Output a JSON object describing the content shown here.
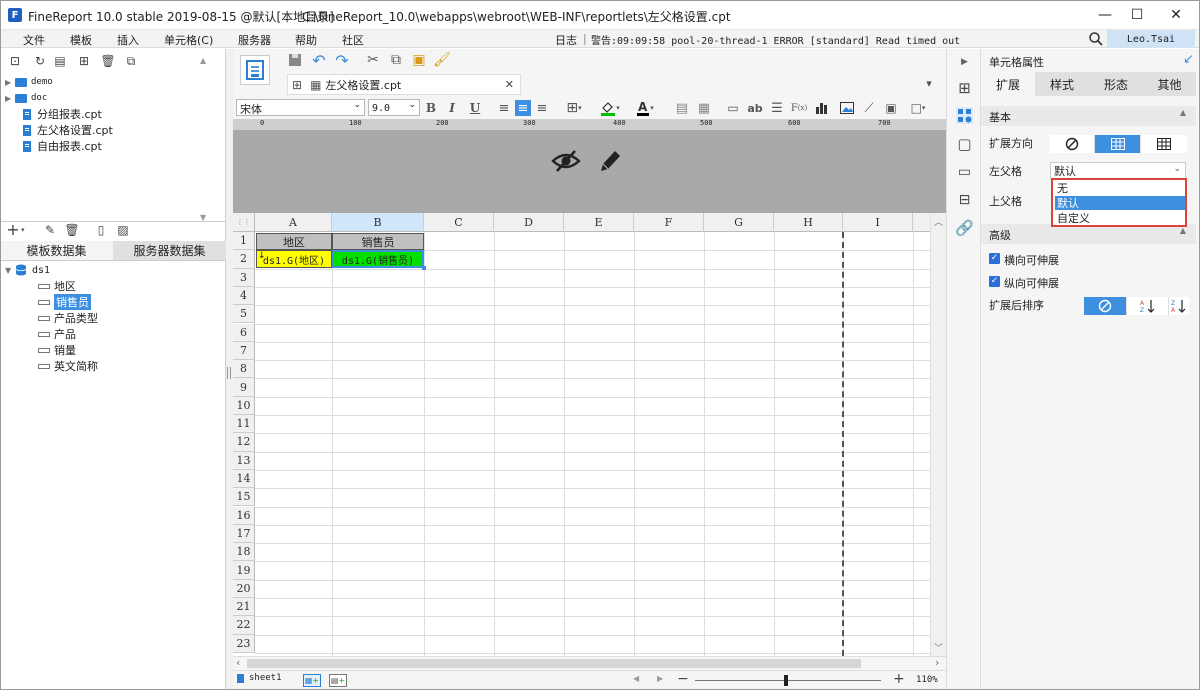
{
  "titlebar": {
    "app_title": "FineReport 10.0 stable 2019-08-15 @默认[本地目录]",
    "file_path": "C:\\FineReport_10.0\\webapps\\webroot\\WEB-INF\\reportlets\\左父格设置.cpt",
    "minimize": "—",
    "maximize": "☐",
    "close": "✕"
  },
  "menu": {
    "items": [
      "文件",
      "模板",
      "插入",
      "单元格(C)",
      "服务器",
      "帮助",
      "社区"
    ],
    "log_label": "日志",
    "warning_text": "警告:09:09:58 pool-20-thread-1 ERROR [standard] Read timed out",
    "user_name": "Leo.Tsai"
  },
  "left_panel": {
    "files": [
      {
        "name": "demo",
        "kind": "folder"
      },
      {
        "name": "doc",
        "kind": "folder"
      },
      {
        "name": "分组报表.cpt",
        "kind": "file"
      },
      {
        "name": "左父格设置.cpt",
        "kind": "file"
      },
      {
        "name": "自由报表.cpt",
        "kind": "file"
      }
    ],
    "dataset_tabs": [
      "模板数据集",
      "服务器数据集"
    ],
    "dataset": {
      "name": "ds1",
      "fields": [
        "地区",
        "销售员",
        "产品类型",
        "产品",
        "销量",
        "英文简称"
      ],
      "selected_field": "销售员"
    }
  },
  "editor": {
    "tab_label": "左父格设置.cpt",
    "font_name": "宋体",
    "font_size": "9.0",
    "bold": "B",
    "italic": "I",
    "underline": "U",
    "ruler_labels": [
      "0",
      "100",
      "200",
      "300",
      "400",
      "500",
      "600",
      "700"
    ],
    "columns": [
      "A",
      "B",
      "C",
      "D",
      "E",
      "F",
      "G",
      "H",
      "I"
    ],
    "rows": [
      "1",
      "2",
      "3",
      "4",
      "5",
      "6",
      "7",
      "8",
      "9",
      "10",
      "11",
      "12",
      "13",
      "14",
      "15",
      "16",
      "17",
      "18",
      "19",
      "20",
      "21",
      "22",
      "23"
    ],
    "cells": {
      "A1": "地区",
      "B1": "销售员",
      "A2": "ds1.G(地区)",
      "B2": "ds1.G(销售员)"
    },
    "sheet_name": "sheet1",
    "zoom": "110%",
    "colors": {
      "a2_fill": "#ffff00",
      "b2_fill": "#00e000",
      "header_fill": "#c0c0c0",
      "selected_column": "#cfe6fb"
    }
  },
  "right_panel": {
    "title": "单元格属性",
    "tabs": [
      "扩展",
      "样式",
      "形态",
      "其他"
    ],
    "active_tab": "扩展",
    "basic_section": "基本",
    "expand_direction_label": "扩展方向",
    "left_parent_label": "左父格",
    "left_parent_value": "默认",
    "top_parent_label": "上父格",
    "dropdown_options": [
      "无",
      "默认",
      "自定义"
    ],
    "dropdown_selected": "默认",
    "advanced_section": "高级",
    "horizontal_expandable": "横向可伸展",
    "vertical_expandable": "纵向可伸展",
    "sort_after_expand": "扩展后排序",
    "accent_color": "#3d8fe0",
    "highlight_border_color": "#d9443b"
  }
}
